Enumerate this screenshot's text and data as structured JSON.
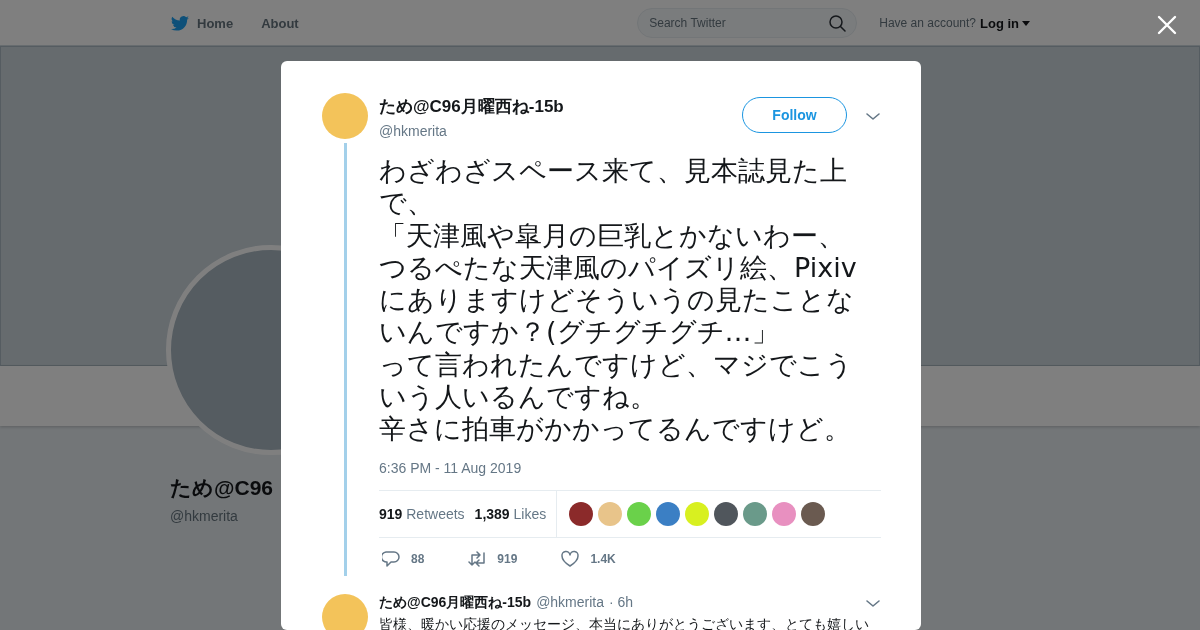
{
  "nav": {
    "items": [
      {
        "label": "Home",
        "kind": "home"
      },
      {
        "label": "About",
        "kind": "plain"
      }
    ],
    "search": {
      "placeholder": "Search Twitter"
    },
    "account_prompt": "Have an account?",
    "login": "Log in"
  },
  "profile": {
    "name": "ため@C96",
    "handle": "@hkmerita"
  },
  "tweet": {
    "name": "ため@C96月曜西ね-15b",
    "handle": "@hkmerita",
    "follow": "Follow",
    "paragraphs": [
      "わざわざスペース来て、見本誌見た上で、",
      "「天津風や皐月の巨乳とかないわー、つるぺたな天津風のパイズリ絵、Pixivにありますけどそういうの見たことないんですか？(グチグチグチ…」",
      "って言われたんですけど、マジでこういう人いるんですね。",
      "辛さに拍車がかかってるんですけど。"
    ],
    "timestamp": "6:36 PM - 11 Aug 2019",
    "stats": [
      {
        "count": "919",
        "label": "Retweets"
      },
      {
        "count": "1,389",
        "label": "Likes"
      }
    ],
    "likers": [
      {
        "color": "#8b2a2a"
      },
      {
        "color": "#e8c48a"
      },
      {
        "color": "#6ad14a"
      },
      {
        "color": "#3b7fc4"
      },
      {
        "color": "#d8f020"
      },
      {
        "color": "#50565c"
      },
      {
        "color": "#6a9a8a"
      },
      {
        "color": "#e890c0"
      },
      {
        "color": "#6a5a50"
      }
    ],
    "actions": [
      {
        "kind": "reply",
        "count": "88"
      },
      {
        "kind": "retweet",
        "count": "919"
      },
      {
        "kind": "like",
        "count": "1.4K"
      }
    ]
  },
  "reply": {
    "name": "ため@C96月曜西ね-15b",
    "handle": "@hkmerita",
    "time": "· 6h",
    "text": "皆様、暖かい応援のメッセージ、本当にありがとうございます、とても嬉しい"
  }
}
